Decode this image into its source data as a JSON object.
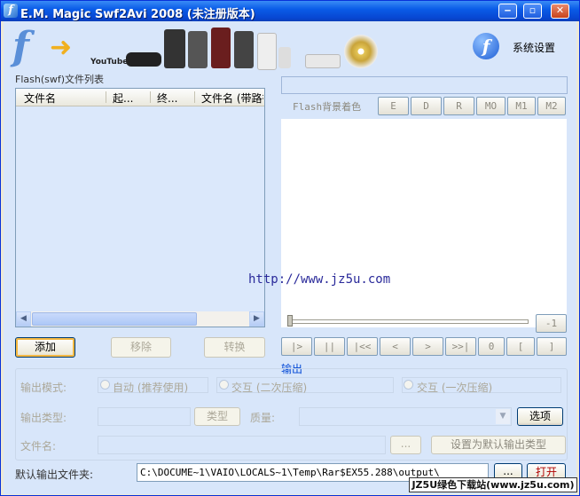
{
  "window": {
    "title": "E.M. Magic Swf2Avi 2008 (未注册版本)",
    "min_glyph": "‒",
    "max_glyph": "▫",
    "close_glyph": "✕"
  },
  "banner": {
    "settings_label": "系统设置",
    "youtube_text": "YouTube"
  },
  "file_list": {
    "label": "Flash(swf)文件列表",
    "columns": [
      "文件名",
      "起...",
      "终...",
      "文件名 (带路径)"
    ]
  },
  "flash_panel": {
    "bg_color_label": "Flash背景着色",
    "buttons": [
      "E",
      "D",
      "R",
      "MO",
      "M1",
      "M2"
    ],
    "frame_counter": "-1",
    "watermark": "http://www.jz5u.com",
    "playback": [
      "|>",
      "||",
      "|<<",
      "<",
      ">",
      ">>|",
      "0",
      "[",
      "]"
    ]
  },
  "actions": {
    "add": "添加",
    "remove": "移除",
    "convert": "转换"
  },
  "output": {
    "group_label": "输出",
    "mode_label": "输出模式:",
    "mode_options": [
      "自动 (推荐使用)",
      "交互 (二次压缩)",
      "交互 (一次压缩)"
    ],
    "type_label": "输出类型:",
    "type_button": "类型",
    "quality_label": "质量:",
    "options_button": "选项",
    "filename_label": "文件名:",
    "browse_button": "...",
    "set_default_button": "设置为默认输出类型"
  },
  "default_folder": {
    "label": "默认输出文件夹:",
    "path": "C:\\DOCUME~1\\VAIO\\LOCALS~1\\Temp\\Rar$EX55.288\\output\\",
    "browse": "...",
    "open": "打开"
  },
  "site_badge": "JZ5U绿色下载站(www.jz5u.com)"
}
